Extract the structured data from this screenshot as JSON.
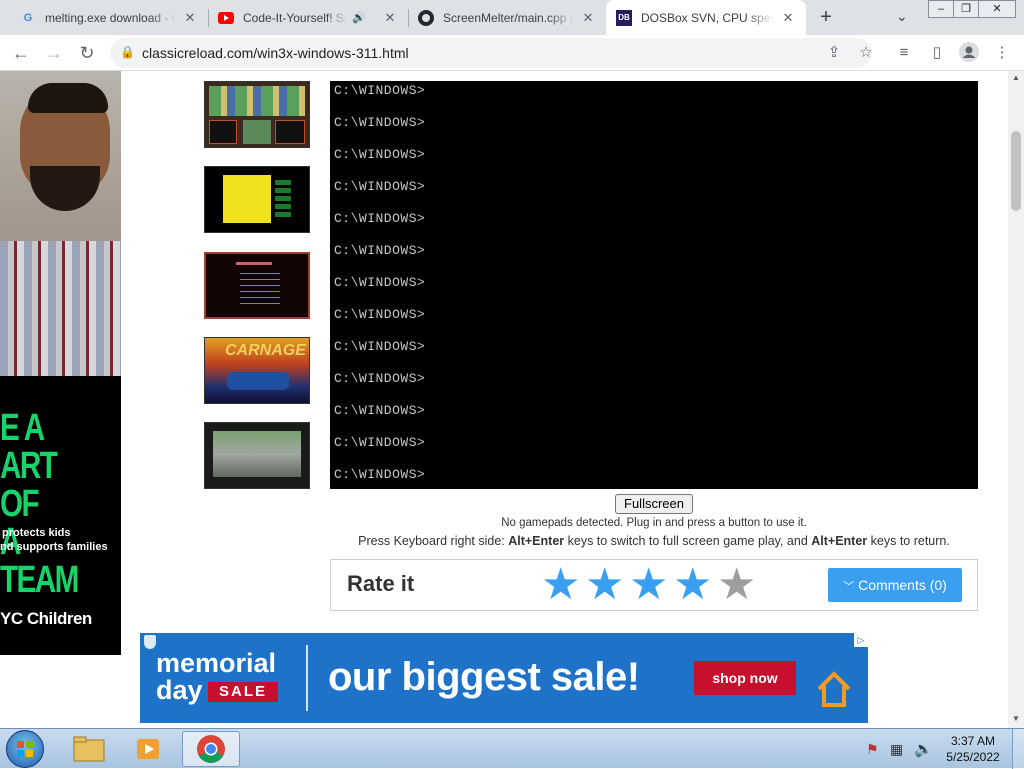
{
  "tabs": [
    {
      "label": "melting.exe download - C",
      "icon": "google-icon",
      "active": false
    },
    {
      "label": "Code-It-Yourself! So",
      "icon": "youtube-icon",
      "active": false
    },
    {
      "label": "ScreenMelter/main.cpp a",
      "icon": "github-icon",
      "active": false
    },
    {
      "label": "DOSBox SVN, CPU speed:",
      "icon": "dosbox-icon",
      "active": true
    }
  ],
  "toolbar": {
    "url": "classicreload.com/win3x-windows-311.html"
  },
  "dos": {
    "lines": [
      "C:\\WINDOWS>",
      "C:\\WINDOWS>",
      "C:\\WINDOWS>",
      "C:\\WINDOWS>",
      "C:\\WINDOWS>",
      "C:\\WINDOWS>",
      "C:\\WINDOWS>",
      "C:\\WINDOWS>",
      "C:\\WINDOWS>",
      "C:\\WINDOWS>",
      "C:\\WINDOWS>",
      "C:\\WINDOWS>",
      "C:\\WINDOWS>"
    ]
  },
  "game": {
    "fullscreen_label": "Fullscreen",
    "gamepad_note": "No gamepads detected. Plug in and press a button to use it.",
    "keyboard_note_prefix": "Press Keyboard right side: ",
    "keyboard_key1": "Alt+Enter",
    "keyboard_note_mid": " keys to switch to full screen game play, and ",
    "keyboard_key2": "Alt+Enter",
    "keyboard_note_suffix": " keys to return."
  },
  "rating": {
    "label": "Rate it",
    "value": 4,
    "max": 5,
    "comments_label": "Comments (0)"
  },
  "left_ad": {
    "headline_lines": [
      "E A",
      "ART OF",
      "A TEAM"
    ],
    "body_lines": [
      "protects kids",
      "nd supports families"
    ],
    "brand": "YC Children"
  },
  "bottom_ad": {
    "left_line1": "memorial",
    "left_line2": "day",
    "sale_badge": "SALE",
    "headline": "our biggest sale!",
    "cta": "shop now"
  },
  "taskbar": {
    "time": "3:37 AM",
    "date": "5/25/2022"
  },
  "colors": {
    "accent_blue": "#3a9ff0",
    "star_filled": "#3a9ff0",
    "star_empty": "#9e9e9e",
    "ad_blue": "#1e73c8",
    "ad_red": "#c8102e"
  }
}
